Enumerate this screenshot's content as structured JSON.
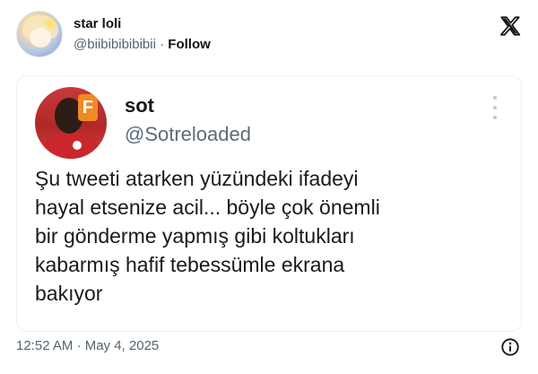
{
  "outer_post": {
    "author_name": "star loli",
    "author_handle": "@biibibibibibii",
    "separator": "·",
    "follow_label": "Follow",
    "timestamp": "12:52 AM · May 4, 2025"
  },
  "embedded_screenshot": {
    "author_name": "sot",
    "author_handle": "@Sotreloaded",
    "badge_letter": "F",
    "text": "Şu tweeti atarken yüzündeki ifadeyi\nhayal etsenize acil... böyle çok önemli\nbir gönderme yapmış gibi koltukları\nkabarmış hafif tebessümle ekrana\nbakıyor"
  },
  "icons": {
    "logo": "x-logo-icon",
    "info": "info-icon",
    "more": "more-options-icon"
  },
  "colors": {
    "text_primary": "#0f1419",
    "text_secondary": "#536471",
    "avatar_red": "#c73a3a",
    "badge_orange": "#f08a24"
  }
}
